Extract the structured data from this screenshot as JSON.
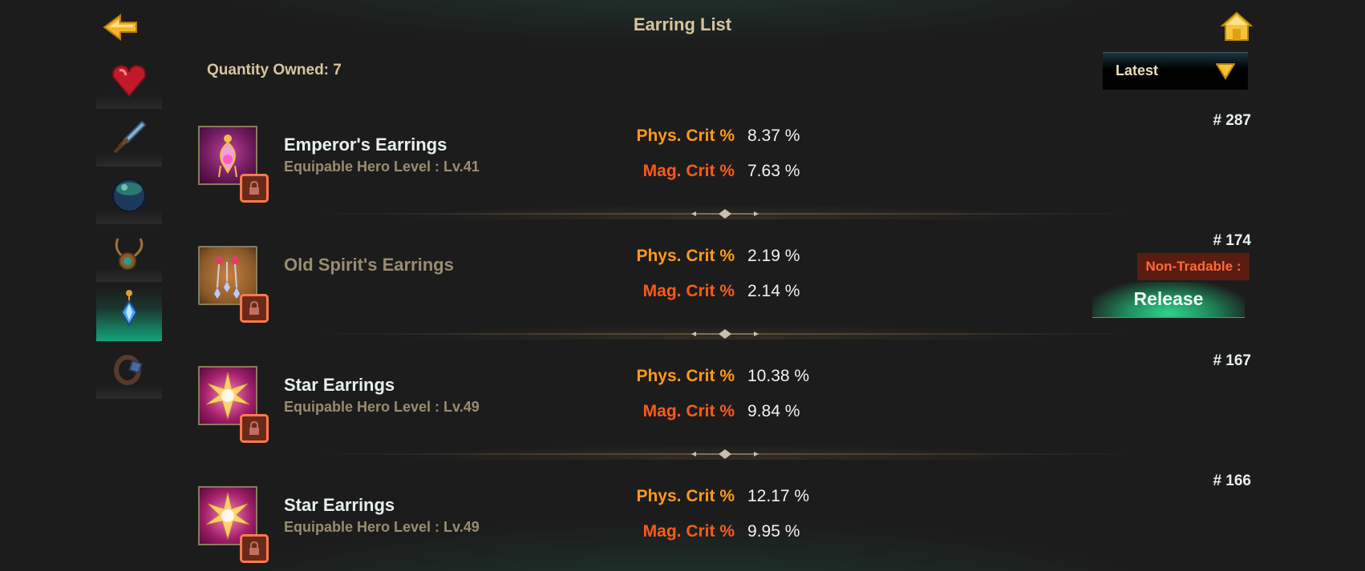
{
  "header": {
    "title": "Earring List",
    "back_icon": "back-arrow-icon",
    "home_icon": "home-icon"
  },
  "summary": {
    "quantity_owned": "Quantity Owned: 7"
  },
  "sort": {
    "selected": "Latest",
    "icon": "chevron-down-icon"
  },
  "sidebar": {
    "tabs": [
      {
        "icon": "heart-gem-icon",
        "active": false
      },
      {
        "icon": "sword-icon",
        "active": false
      },
      {
        "icon": "orb-icon",
        "active": false
      },
      {
        "icon": "necklace-icon",
        "active": false
      },
      {
        "icon": "earring-icon",
        "active": true
      },
      {
        "icon": "ring-icon",
        "active": false
      }
    ]
  },
  "stat_labels": {
    "phys": "Phys. Crit %",
    "mag": "Mag. Crit %"
  },
  "items": [
    {
      "number": "# 287",
      "name": "Emperor's Earrings",
      "requirement": "Equipable Hero Level : Lv.41",
      "phys": "8.37 %",
      "mag": "7.63 %",
      "locked": true,
      "icon": "emperor-earrings-icon"
    },
    {
      "number": "# 174",
      "name": "Old Spirit's Earrings",
      "requirement": "",
      "phys": "2.19 %",
      "mag": "2.14 %",
      "locked": true,
      "icon": "old-spirit-earrings-icon",
      "non_tradable": "Non-Tradable :",
      "release": "Release"
    },
    {
      "number": "# 167",
      "name": "Star Earrings",
      "requirement": "Equipable Hero Level : Lv.49",
      "phys": "10.38 %",
      "mag": "9.84 %",
      "locked": true,
      "icon": "star-earrings-icon"
    },
    {
      "number": "# 166",
      "name": "Star Earrings",
      "requirement": "Equipable Hero Level : Lv.49",
      "phys": "12.17 %",
      "mag": "9.95 %",
      "locked": true,
      "icon": "star-earrings-icon"
    }
  ],
  "colors": {
    "background": "#1c1c1c",
    "accent_gold": "#d9c49e",
    "phys_label": "#ff9a1a",
    "mag_label": "#ff5a1a",
    "active_tab": "#14a57e",
    "lock_border": "#ff7a4a"
  }
}
